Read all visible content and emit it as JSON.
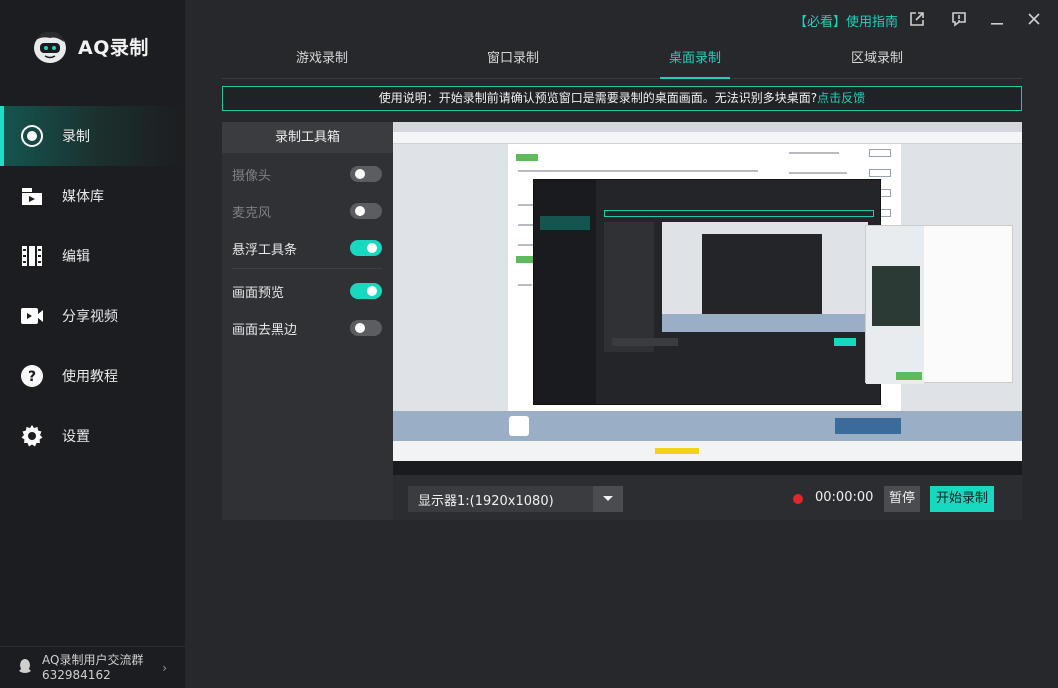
{
  "app": {
    "title": "AQ录制"
  },
  "sidebar": {
    "items": [
      {
        "label": "录制",
        "icon": "record-icon",
        "active": true
      },
      {
        "label": "媒体库",
        "icon": "media-library-icon"
      },
      {
        "label": "编辑",
        "icon": "film-edit-icon"
      },
      {
        "label": "分享视频",
        "icon": "video-share-icon"
      },
      {
        "label": "使用教程",
        "icon": "help-icon"
      },
      {
        "label": "设置",
        "icon": "gear-icon"
      }
    ],
    "community": {
      "title": "AQ录制用户交流群",
      "number": "632984162",
      "icon": "qq-icon"
    }
  },
  "topbar": {
    "guide": "【必看】使用指南",
    "icons": [
      "external-link-icon",
      "feedback-icon",
      "minimize-icon",
      "close-icon"
    ]
  },
  "tabs": [
    "游戏录制",
    "窗口录制",
    "桌面录制",
    "区域录制"
  ],
  "active_tab": "桌面录制",
  "notice": {
    "text": "使用说明：开始录制前请确认预览窗口是需要录制的桌面画面。无法识别多块桌面?",
    "link": "点击反馈"
  },
  "toolbox": {
    "title": "录制工具箱",
    "toggles": [
      {
        "label": "摄像头",
        "on": false,
        "disabled": true
      },
      {
        "label": "麦克风",
        "on": false,
        "disabled": true
      },
      {
        "label": "悬浮工具条",
        "on": true,
        "disabled": false
      },
      {
        "label": "画面预览",
        "on": true,
        "disabled": false
      },
      {
        "label": "画面去黑边",
        "on": false,
        "disabled": false
      }
    ]
  },
  "controls": {
    "display": "显示器1:(1920x1080)",
    "timer": "00:00:00",
    "pause": "暂停",
    "start": "开始录制"
  },
  "colors": {
    "accent": "#18d8bf",
    "record_dot": "#e2262b",
    "sidebar_bg": "#1c1d20",
    "main_bg": "#26282b"
  }
}
